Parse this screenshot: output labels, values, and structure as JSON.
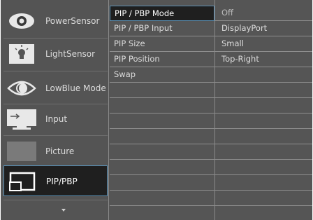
{
  "main_menu": [
    {
      "label": "PowerSensor",
      "icon": "eye-icon"
    },
    {
      "label": "LightSensor",
      "icon": "lightbulb-icon"
    },
    {
      "label": "LowBlue Mode",
      "icon": "lowblue-eye-icon"
    },
    {
      "label": "Input",
      "icon": "input-icon"
    },
    {
      "label": "Picture",
      "icon": "picture-icon"
    },
    {
      "label": "PIP/PBP",
      "icon": "pip-icon"
    }
  ],
  "submenu": [
    "PIP / PBP Mode",
    "PIP / PBP Input",
    "PIP Size",
    "PIP Position",
    "Swap"
  ],
  "values": [
    "Off",
    "DisplayPort",
    "Small",
    "Top-Right"
  ],
  "colors": {
    "background": "#545454",
    "selected_bg": "#1f1f1f",
    "selected_border": "#5a8fb3",
    "text": "#dcdcdc"
  }
}
